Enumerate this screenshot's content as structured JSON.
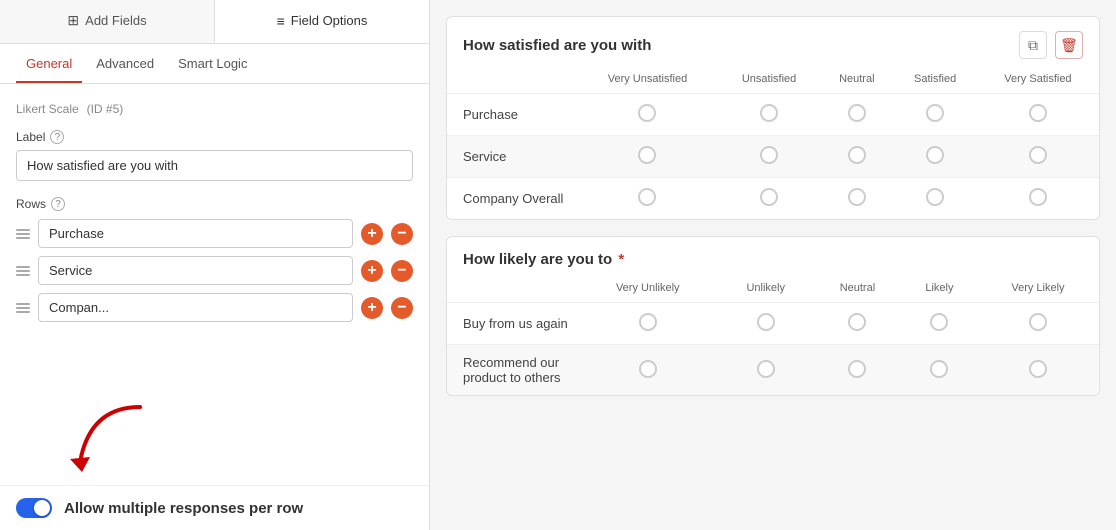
{
  "leftPanel": {
    "tabs": [
      {
        "id": "add-fields",
        "label": "Add Fields",
        "icon": "grid-icon",
        "active": false
      },
      {
        "id": "field-options",
        "label": "Field Options",
        "icon": "sliders-icon",
        "active": true
      }
    ],
    "subTabs": [
      {
        "id": "general",
        "label": "General",
        "active": true
      },
      {
        "id": "advanced",
        "label": "Advanced",
        "active": false
      },
      {
        "id": "smart-logic",
        "label": "Smart Logic",
        "active": false
      }
    ],
    "fieldTitle": "Likert Scale",
    "fieldId": "(ID #5)",
    "labelSection": {
      "label": "Label",
      "helpTitle": "?",
      "value": "How satisfied are you with"
    },
    "rowsSection": {
      "label": "Rows",
      "helpTitle": "?",
      "rows": [
        {
          "id": 1,
          "value": "Purchase"
        },
        {
          "id": 2,
          "value": "Service"
        },
        {
          "id": 3,
          "value": "Compan..."
        }
      ]
    },
    "bottomBar": {
      "toggleOn": true,
      "label": "Allow multiple responses per row"
    }
  },
  "rightPanel": {
    "cards": [
      {
        "id": "card-1",
        "title": "How satisfied are you with",
        "required": false,
        "columns": [
          "Very Unsatisfied",
          "Unsatisfied",
          "Neutral",
          "Satisfied",
          "Very Satisfied"
        ],
        "rows": [
          {
            "label": "Purchase"
          },
          {
            "label": "Service"
          },
          {
            "label": "Company Overall"
          }
        ]
      },
      {
        "id": "card-2",
        "title": "How likely are you to",
        "required": true,
        "columns": [
          "Very Unlikely",
          "Unlikely",
          "Neutral",
          "Likely",
          "Very Likely"
        ],
        "rows": [
          {
            "label": "Buy from us again"
          },
          {
            "label": "Recommend our product to others"
          }
        ]
      }
    ]
  },
  "icons": {
    "copy": "⧉",
    "delete": "🗑",
    "drag": "≡",
    "grid": "⊞",
    "sliders": "⚙"
  }
}
